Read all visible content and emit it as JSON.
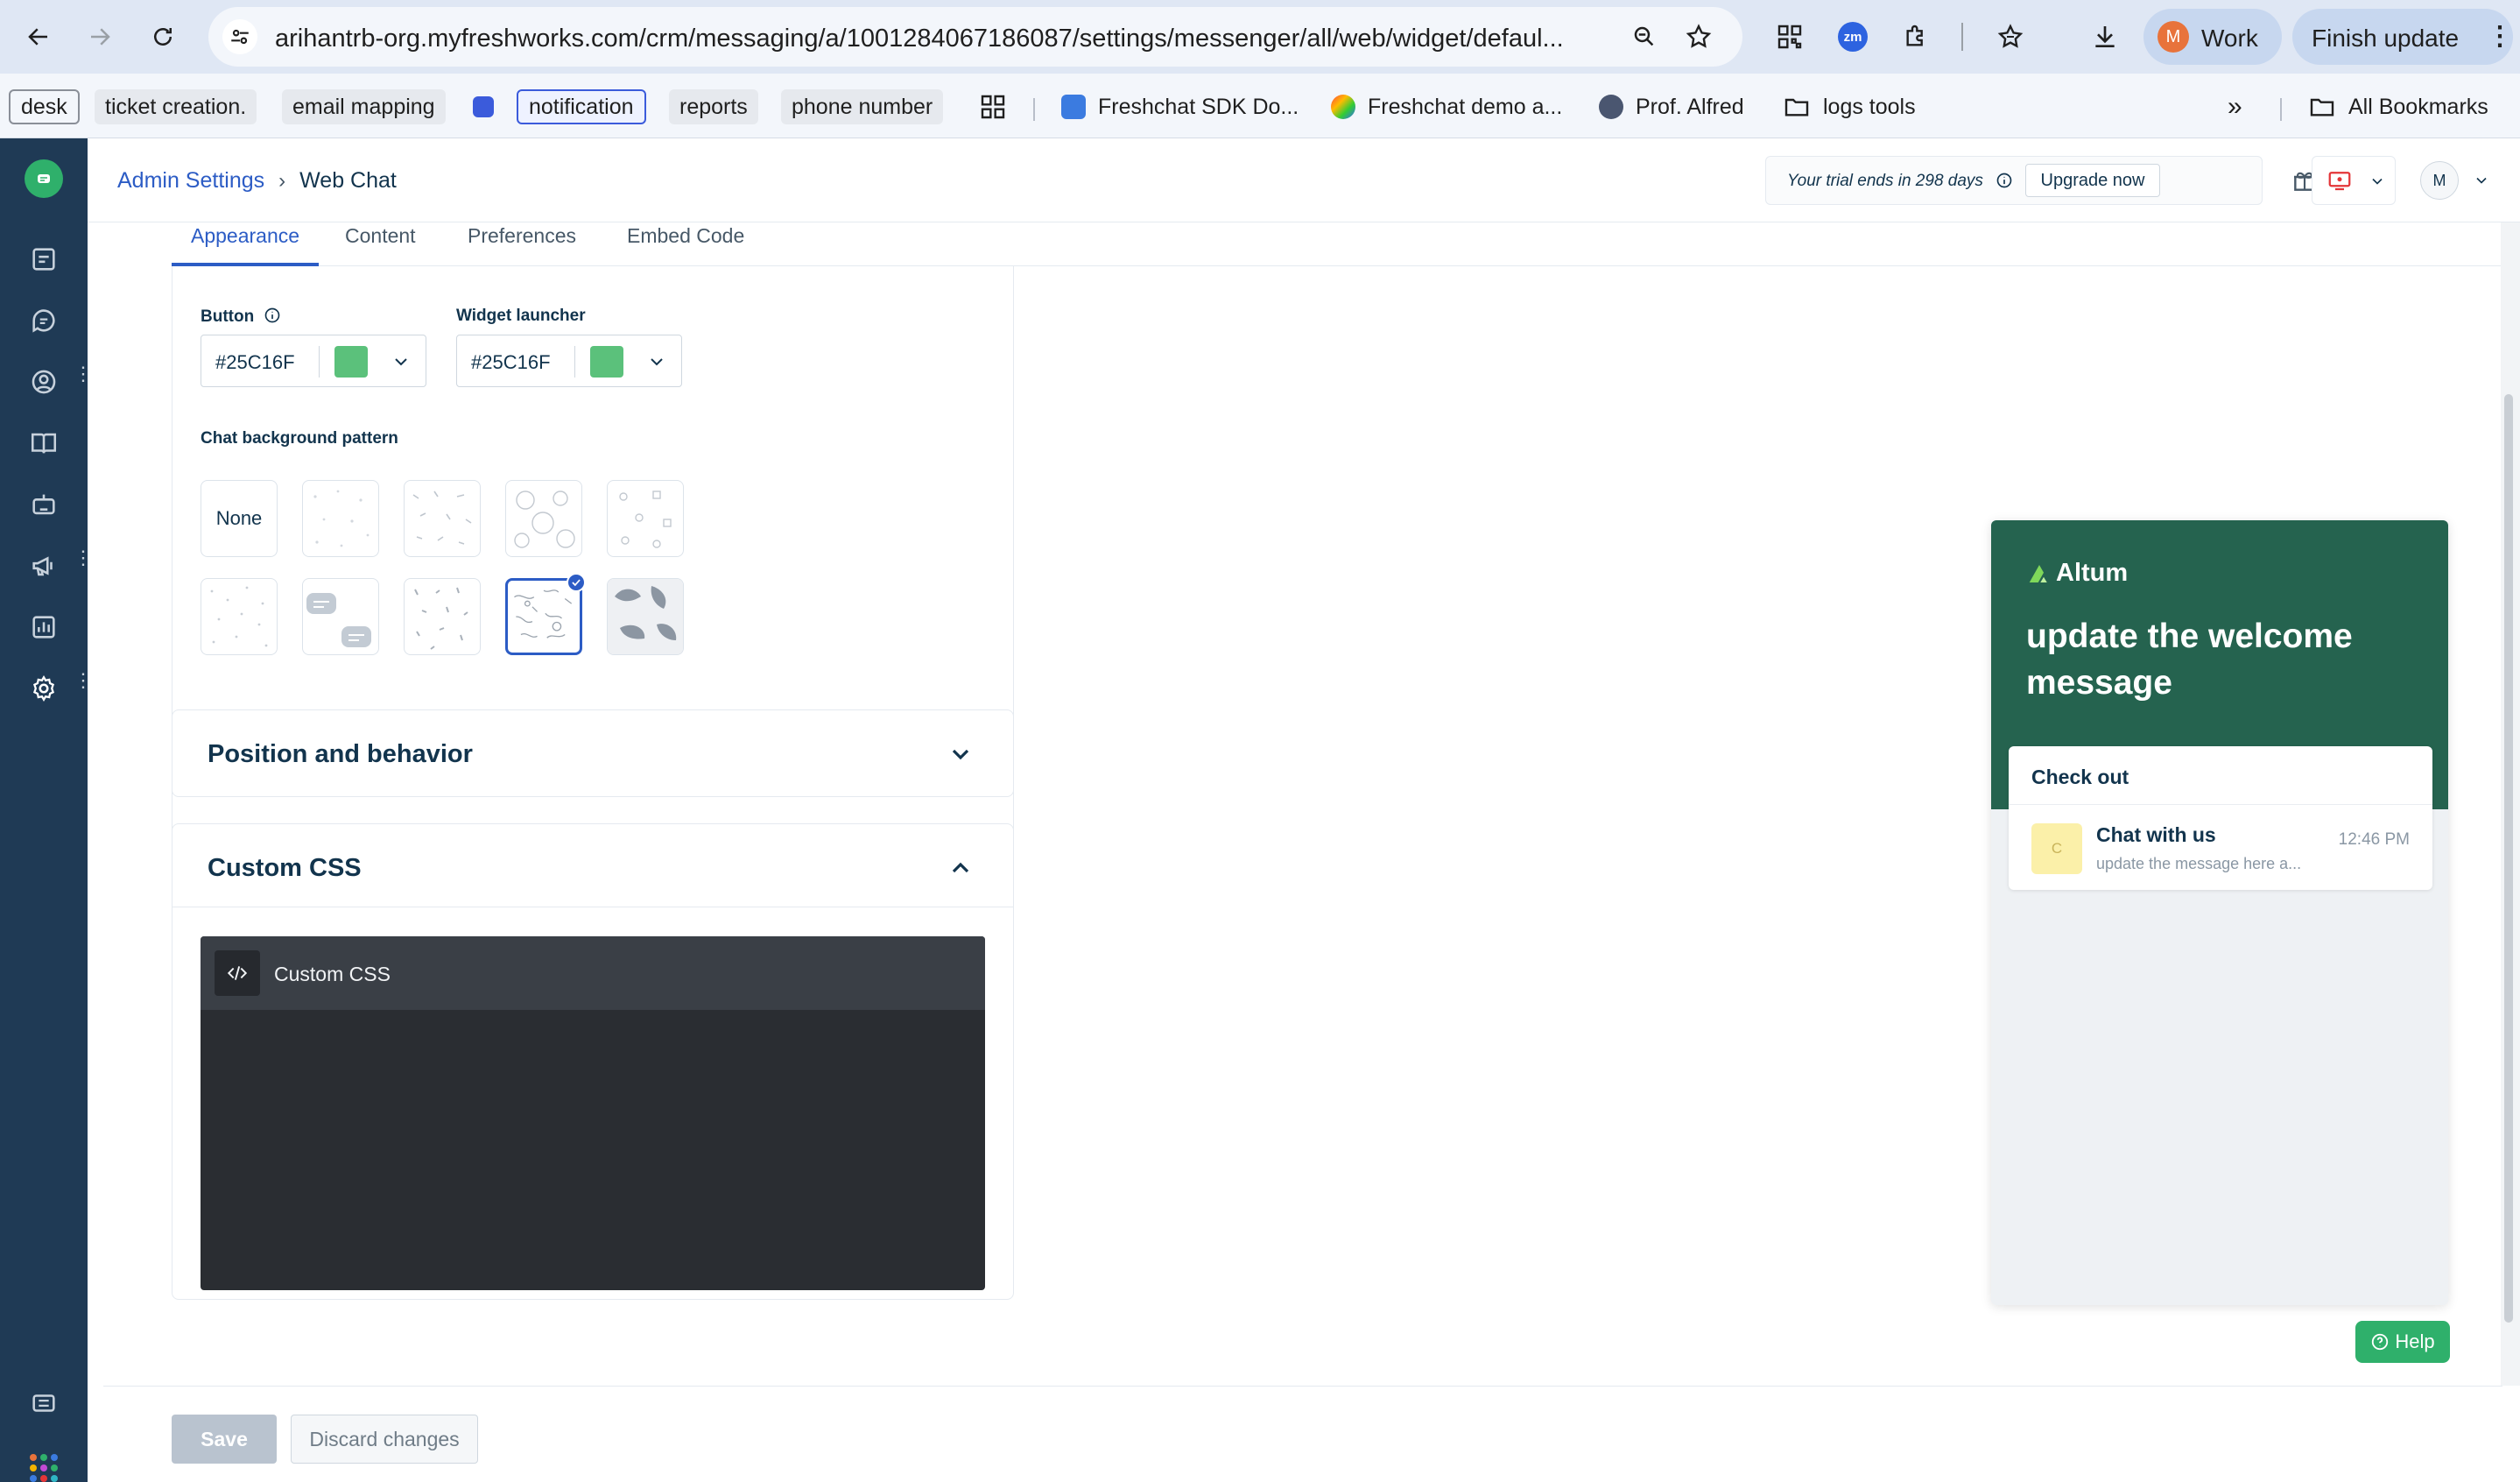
{
  "browser": {
    "url": "arihantrb-org.myfreshworks.com/crm/messaging/a/1001284067186087/settings/messenger/all/web/widget/defaul...",
    "profile_initial": "M",
    "profile_label": "Work",
    "finish_update_label": "Finish update",
    "zm_label": "zm",
    "bookmarks": [
      {
        "label": "desk"
      },
      {
        "label": "ticket creation."
      },
      {
        "label": "email mapping"
      },
      {
        "label": "notification"
      },
      {
        "label": "reports"
      },
      {
        "label": "phone number"
      },
      {
        "label": "Freshchat SDK Do..."
      },
      {
        "label": "Freshchat demo a..."
      },
      {
        "label": "Prof. Alfred"
      },
      {
        "label": "logs tools"
      }
    ],
    "all_bookmarks_label": "All Bookmarks"
  },
  "header": {
    "breadcrumb_parent": "Admin Settings",
    "breadcrumb_current": "Web Chat",
    "trial_text": "Your trial ends in 298 days",
    "upgrade_label": "Upgrade now",
    "user_initial": "M"
  },
  "tabs": [
    {
      "label": "Appearance",
      "active": true
    },
    {
      "label": "Content"
    },
    {
      "label": "Preferences"
    },
    {
      "label": "Embed Code"
    }
  ],
  "appearance": {
    "button_label": "Button",
    "button_color": "#25C16F",
    "launcher_label": "Widget launcher",
    "launcher_color": "#25C16F",
    "pattern_label": "Chat background pattern",
    "pattern_none": "None",
    "selected_pattern_index": 8
  },
  "sections": {
    "position_title": "Position and behavior",
    "custom_css_title": "Custom CSS",
    "editor_label": "Custom CSS"
  },
  "preview": {
    "brand": "Altum",
    "welcome": "update the welcome message",
    "check_out": "Check out",
    "conversation_avatar": "C",
    "conversation_title": "Chat with us",
    "conversation_subtitle": "update the message here a...",
    "conversation_time": "12:46 PM",
    "header_color": "#25634f"
  },
  "help_label": "Help",
  "footer": {
    "save_label": "Save",
    "discard_label": "Discard changes"
  }
}
